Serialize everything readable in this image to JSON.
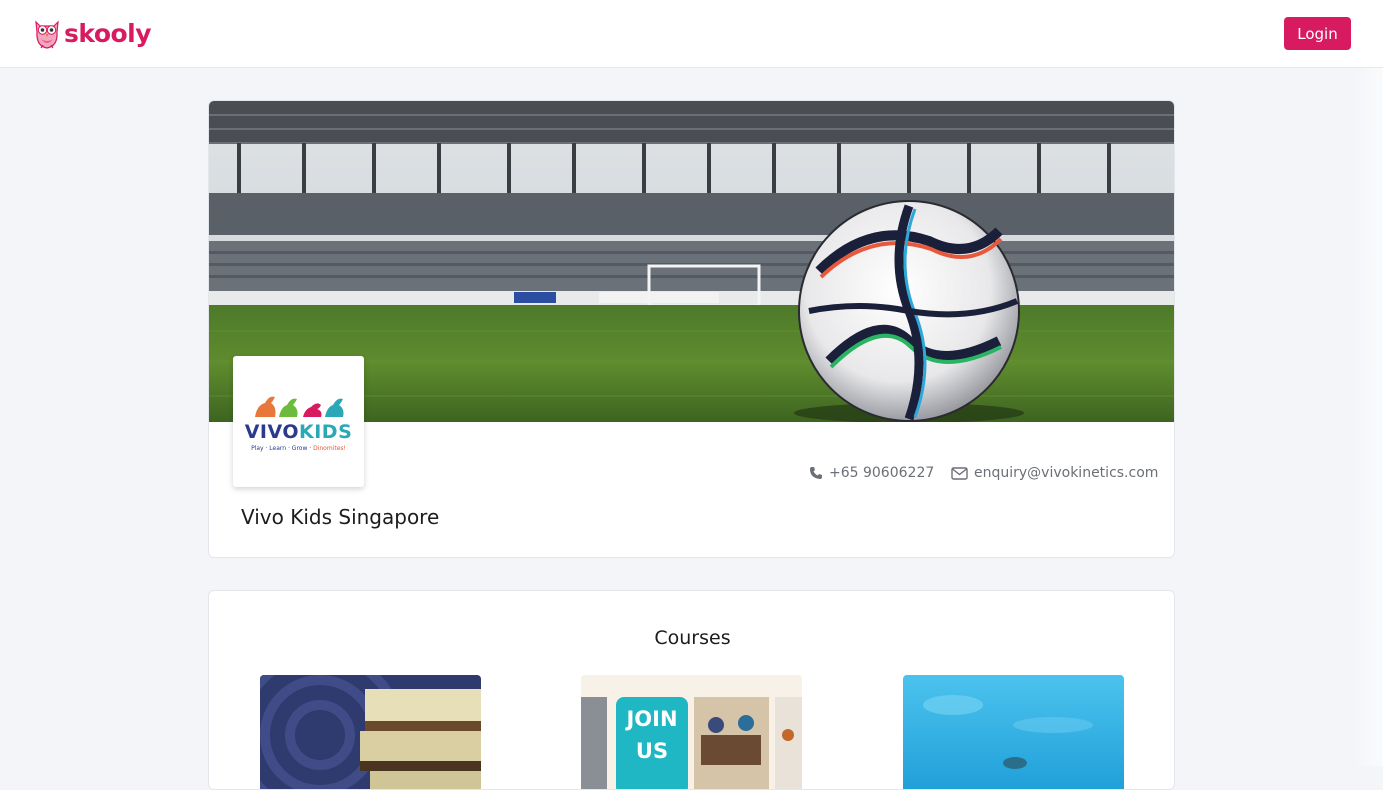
{
  "header": {
    "brand_name": "skooly",
    "login_label": "Login"
  },
  "profile": {
    "banner_icon": "soccer-stadium-banner",
    "logo": {
      "word_vivo": "VIVO",
      "word_kids": "KIDS",
      "tagline_prefix": "Play · Learn · Grow · ",
      "tagline_highlight": "Dinomites!"
    },
    "phone": "+65 90606227",
    "email": "enquiry@vivokinetics.com",
    "name": "Vivo Kids Singapore"
  },
  "courses": {
    "title": "Courses",
    "items": [
      {
        "thumb_icon": "books-thumbnail"
      },
      {
        "thumb_icon": "join-us-thumbnail",
        "badge_text": "JOIN US"
      },
      {
        "thumb_icon": "swimming-pool-thumbnail"
      }
    ]
  },
  "colors": {
    "brand": "#d81b60",
    "background": "#f3f5f9",
    "text_muted": "#6b6f76"
  }
}
